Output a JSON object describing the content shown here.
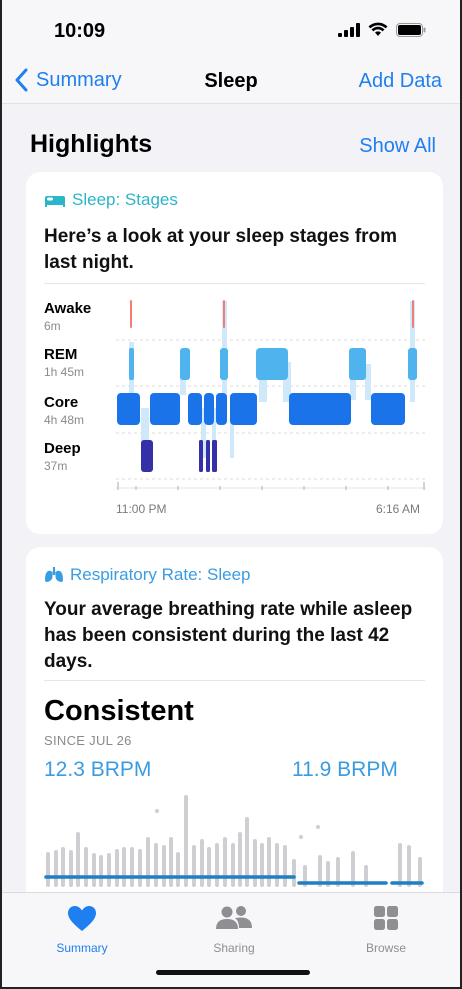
{
  "status": {
    "time": "10:09"
  },
  "nav": {
    "back_label": "Summary",
    "title": "Sleep",
    "action_label": "Add Data"
  },
  "section": {
    "title": "Highlights",
    "show_all": "Show All"
  },
  "sleep_card": {
    "category": "Sleep: Stages",
    "text_line1": "Here’s a look at your sleep stages from",
    "text_line2": "last night.",
    "accent": "#2bb5c8",
    "stages": [
      {
        "name": "Awake",
        "duration": "6m"
      },
      {
        "name": "REM",
        "duration": "1h 45m"
      },
      {
        "name": "Core",
        "duration": "4h 48m"
      },
      {
        "name": "Deep",
        "duration": "37m"
      }
    ],
    "start_time": "11:00 PM",
    "end_time": "6:16 AM"
  },
  "resp_card": {
    "category": "Respiratory Rate: Sleep",
    "text_line1": "Your average breathing rate while asleep",
    "text_line2": "has been consistent during the last 42",
    "text_line3": "days.",
    "status": "Consistent",
    "since": "SINCE JUL 26",
    "rate_left": "12.3 BRPM",
    "rate_right": "11.9 BRPM",
    "accent": "#3a9ce0"
  },
  "tabs": [
    {
      "label": "Summary",
      "icon": "heart-icon",
      "active": true
    },
    {
      "label": "Sharing",
      "icon": "people-icon",
      "active": false
    },
    {
      "label": "Browse",
      "icon": "grid-icon",
      "active": false
    }
  ],
  "colors": {
    "accent": "#1f7ff0",
    "awake": "#f27d72",
    "rem": "#4fb3ee",
    "core": "#1a73e8",
    "deep": "#3630a8"
  }
}
